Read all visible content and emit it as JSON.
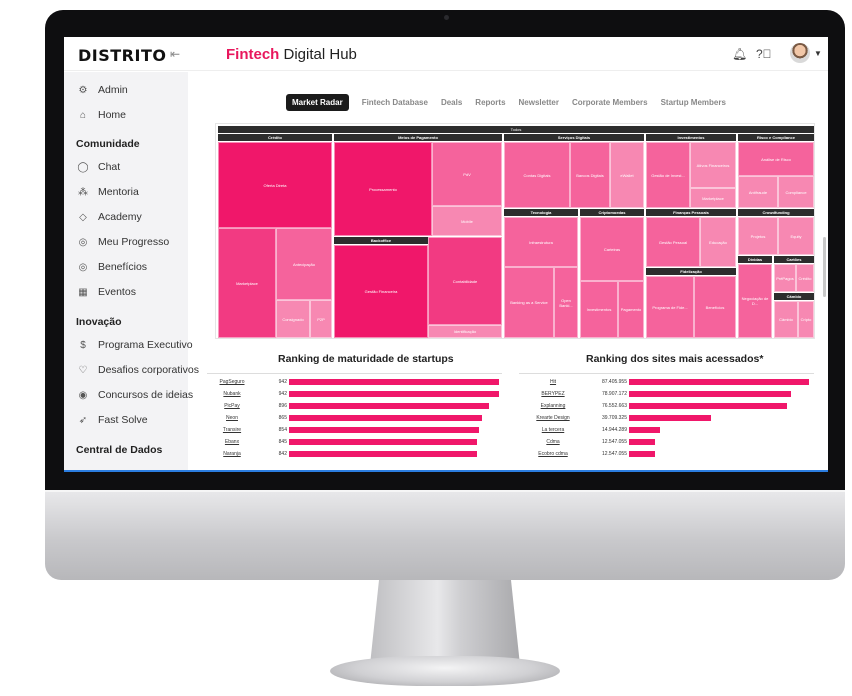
{
  "header": {
    "logo": "DISTRITO",
    "title_brand": "Fintech",
    "title_rest": " Digital Hub"
  },
  "sidebar": {
    "top": [
      {
        "label": "Admin",
        "icon": "gear-icon",
        "glyph": "⚙"
      },
      {
        "label": "Home",
        "icon": "home-icon",
        "glyph": "⌂"
      }
    ],
    "comunidade_label": "Comunidade",
    "comunidade": [
      {
        "label": "Chat",
        "icon": "chat-icon",
        "glyph": "◯"
      },
      {
        "label": "Mentoria",
        "icon": "people-icon",
        "glyph": "⁂"
      },
      {
        "label": "Academy",
        "icon": "academy-icon",
        "glyph": "◇"
      },
      {
        "label": "Meu Progresso",
        "icon": "progress-icon",
        "glyph": "◎"
      },
      {
        "label": "Benefícios",
        "icon": "benefits-icon",
        "glyph": "◎"
      },
      {
        "label": "Eventos",
        "icon": "calendar-icon",
        "glyph": "▦"
      }
    ],
    "inovacao_label": "Inovação",
    "inovacao": [
      {
        "label": "Programa Executivo",
        "icon": "dollar-icon",
        "glyph": "$"
      },
      {
        "label": "Desafios corporativos",
        "icon": "trophy-icon",
        "glyph": "♡"
      },
      {
        "label": "Concursos de ideias",
        "icon": "idea-icon",
        "glyph": "◉"
      },
      {
        "label": "Fast Solve",
        "icon": "rocket-icon",
        "glyph": "➶"
      }
    ],
    "dados_label": "Central de Dados"
  },
  "tabs": [
    "Market Radar",
    "Fintech Database",
    "Deals",
    "Reports",
    "Newsletter",
    "Corporate Members",
    "Startup Members"
  ],
  "treemap": {
    "root": "Todos",
    "headers": [
      {
        "label": "Crédito"
      },
      {
        "label": "Meios de Pagamento"
      },
      {
        "label": "Serviços Digitais"
      },
      {
        "label": "Investimentos"
      },
      {
        "label": "Risco e Compliance"
      },
      {
        "label": "Backoffice"
      },
      {
        "label": "Tecnologia"
      },
      {
        "label": "Criptomoedas"
      },
      {
        "label": "Finanças Pessoais"
      },
      {
        "label": "Crowdfunding"
      },
      {
        "label": "Dívidas"
      },
      {
        "label": "Cartões"
      },
      {
        "label": "Fidelização"
      },
      {
        "label": "Câmbio"
      }
    ],
    "cells": [
      {
        "label": "Oferta Direta"
      },
      {
        "label": "Marketplace"
      },
      {
        "label": "Antecipação"
      },
      {
        "label": "Consignado"
      },
      {
        "label": "P2P"
      },
      {
        "label": "Processamento"
      },
      {
        "label": "PdV"
      },
      {
        "label": "Mobile"
      },
      {
        "label": "Gestão Financeira"
      },
      {
        "label": "Contabilidade"
      },
      {
        "label": "Identificação"
      },
      {
        "label": "Contas Digitais"
      },
      {
        "label": "Bancos Digitais"
      },
      {
        "label": "eWallet"
      },
      {
        "label": "Infraestrutura"
      },
      {
        "label": "Banking as a Service"
      },
      {
        "label": "Open Banki..."
      },
      {
        "label": "Carteiras"
      },
      {
        "label": "Investimentos"
      },
      {
        "label": "Pagamento"
      },
      {
        "label": "Gestão de Invest..."
      },
      {
        "label": "Ativos Financeiros"
      },
      {
        "label": "Marketplace"
      },
      {
        "label": "Análise de Risco"
      },
      {
        "label": "Antifraude"
      },
      {
        "label": "Compliance"
      },
      {
        "label": "Gestão Pessoal"
      },
      {
        "label": "Educação"
      },
      {
        "label": "Projetos"
      },
      {
        "label": "Equity"
      },
      {
        "label": "Negociação de D..."
      },
      {
        "label": "PréPagos"
      },
      {
        "label": "Crédito"
      },
      {
        "label": "Programa de Fide..."
      },
      {
        "label": "Benefícios"
      },
      {
        "label": "Câmbio"
      },
      {
        "label": "Cripto"
      }
    ]
  },
  "ranking_startups": {
    "title": "Ranking de maturidade de startups",
    "rows": [
      {
        "name": "PagSeguro",
        "value": "942",
        "v": 942
      },
      {
        "name": "Nubank",
        "value": "942",
        "v": 942
      },
      {
        "name": "PicPay",
        "value": "896",
        "v": 896
      },
      {
        "name": "Neon",
        "value": "865",
        "v": 865
      },
      {
        "name": "Transire",
        "value": "854",
        "v": 854
      },
      {
        "name": "Ebanx",
        "value": "845",
        "v": 845
      },
      {
        "name": "Naranja",
        "value": "842",
        "v": 842
      }
    ]
  },
  "ranking_sites": {
    "title": "Ranking dos sites mais acessados*",
    "rows": [
      {
        "name": "Hit",
        "value": "87.405.955",
        "v": 87405955
      },
      {
        "name": "BERYPEZ",
        "value": "78.907.172",
        "v": 78907172
      },
      {
        "name": "Explanning",
        "value": "76.552.663",
        "v": 76552663
      },
      {
        "name": "Krearte Design",
        "value": "39.709.325",
        "v": 39709325
      },
      {
        "name": "La tercera",
        "value": "14.944.289",
        "v": 14944289
      },
      {
        "name": "Cdma",
        "value": "12.547.055",
        "v": 12547055
      },
      {
        "name": "Ecobro cdma",
        "value": "12.547.055",
        "v": 12547055
      }
    ]
  },
  "colors": {
    "accent": "#e8175d",
    "shade1": "#f0176a",
    "shade2": "#f23a82",
    "shade3": "#f5639c",
    "shade4": "#f788b2"
  }
}
